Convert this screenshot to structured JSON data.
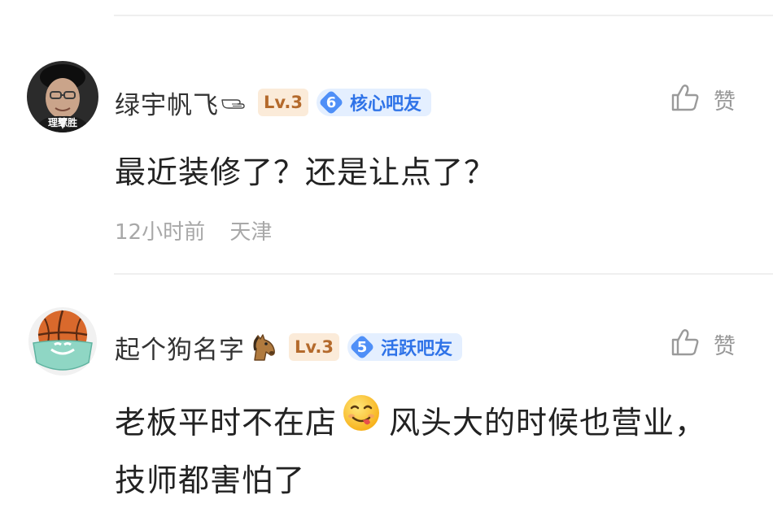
{
  "comments": [
    {
      "username": "绿宇帆飞",
      "level": "Lv.3",
      "badge_level": "6",
      "badge_label": "核心吧友",
      "like_label": "赞",
      "content": "最近装修了？还是让点了？",
      "time": "12小时前",
      "location": "天津",
      "avatar_caption": "理综胜"
    },
    {
      "username": "起个狗名字",
      "level": "Lv.3",
      "badge_level": "5",
      "badge_label": "活跃吧友",
      "like_label": "赞",
      "content_part1": "老板平时不在店",
      "content_part2": "风头大的时候也营业，",
      "content_line2": "技师都害怕了"
    }
  ],
  "colors": {
    "level_badge_bg": "#fbebd9",
    "level_badge_text": "#b46a2c",
    "member_badge_bg": "#e4efff",
    "member_badge_text": "#2f73e8",
    "diamond": "#4f8ff7"
  },
  "icons": {
    "username_suffix_1": "pointing-hand-icon",
    "username_suffix_2": "horse-icon",
    "inline_emoji": "yum-face-emoji",
    "like": "thumbs-up-icon"
  }
}
